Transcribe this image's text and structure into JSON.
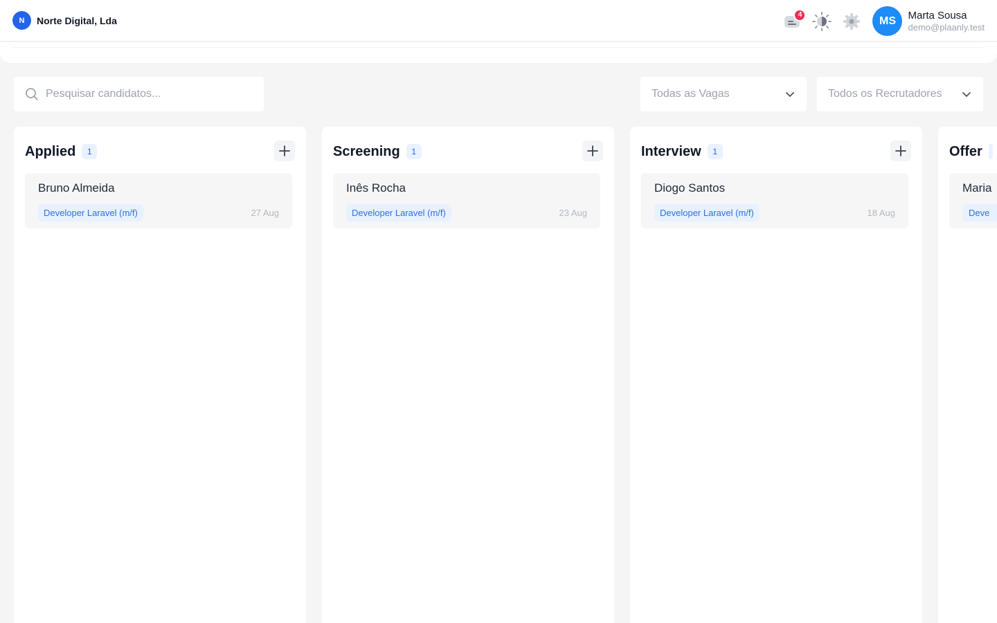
{
  "org": {
    "badge": "N",
    "name": "Norte Digital, Lda"
  },
  "header": {
    "notifications_count": "4",
    "user": {
      "initials": "MS",
      "name": "Marta Sousa",
      "email": "demo@plaanly.test"
    }
  },
  "search": {
    "placeholder": "Pesquisar candidatos..."
  },
  "filters": {
    "vagas": "Todas as Vagas",
    "recrutadores": "Todos os Recrutadores"
  },
  "columns": [
    {
      "title": "Applied",
      "count": "1",
      "card": {
        "name": "Bruno Almeida",
        "tag": "Developer Laravel (m/f)",
        "date": "27 Aug"
      }
    },
    {
      "title": "Screening",
      "count": "1",
      "card": {
        "name": "Inês Rocha",
        "tag": "Developer Laravel (m/f)",
        "date": "23 Aug"
      }
    },
    {
      "title": "Interview",
      "count": "1",
      "card": {
        "name": "Diogo Santos",
        "tag": "Developer Laravel (m/f)",
        "date": "18 Aug"
      }
    },
    {
      "title": "Offer",
      "count": "",
      "card": {
        "name": "Maria",
        "tag": "Deve",
        "date": ""
      }
    }
  ],
  "colors": {
    "accent": "#2563eb",
    "avatar": "#1d8cf8",
    "badge": "#ef2e55",
    "tag_bg": "#e8f1ff"
  }
}
